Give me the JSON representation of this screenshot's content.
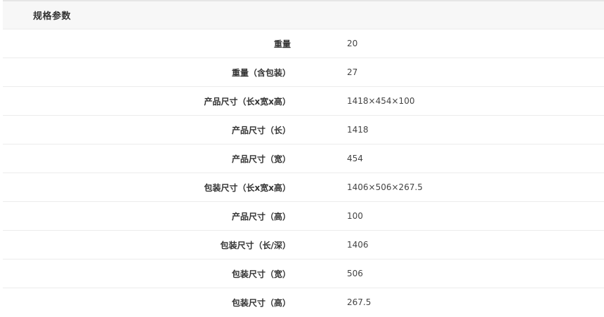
{
  "header": {
    "title": "规格参数"
  },
  "rows": [
    {
      "label": "重量",
      "value": "20"
    },
    {
      "label": "重量（含包装）",
      "value": "27"
    },
    {
      "label": "产品尺寸（长x宽x高）",
      "value": "1418×454×100"
    },
    {
      "label": "产品尺寸（长）",
      "value": "1418"
    },
    {
      "label": "产品尺寸（宽）",
      "value": "454"
    },
    {
      "label": "包装尺寸（长x宽x高）",
      "value": "1406×506×267.5"
    },
    {
      "label": "产品尺寸（高）",
      "value": "100"
    },
    {
      "label": "包装尺寸（长/深）",
      "value": "1406"
    },
    {
      "label": "包装尺寸（宽）",
      "value": "506"
    },
    {
      "label": "包装尺寸（高）",
      "value": "267.5"
    }
  ]
}
